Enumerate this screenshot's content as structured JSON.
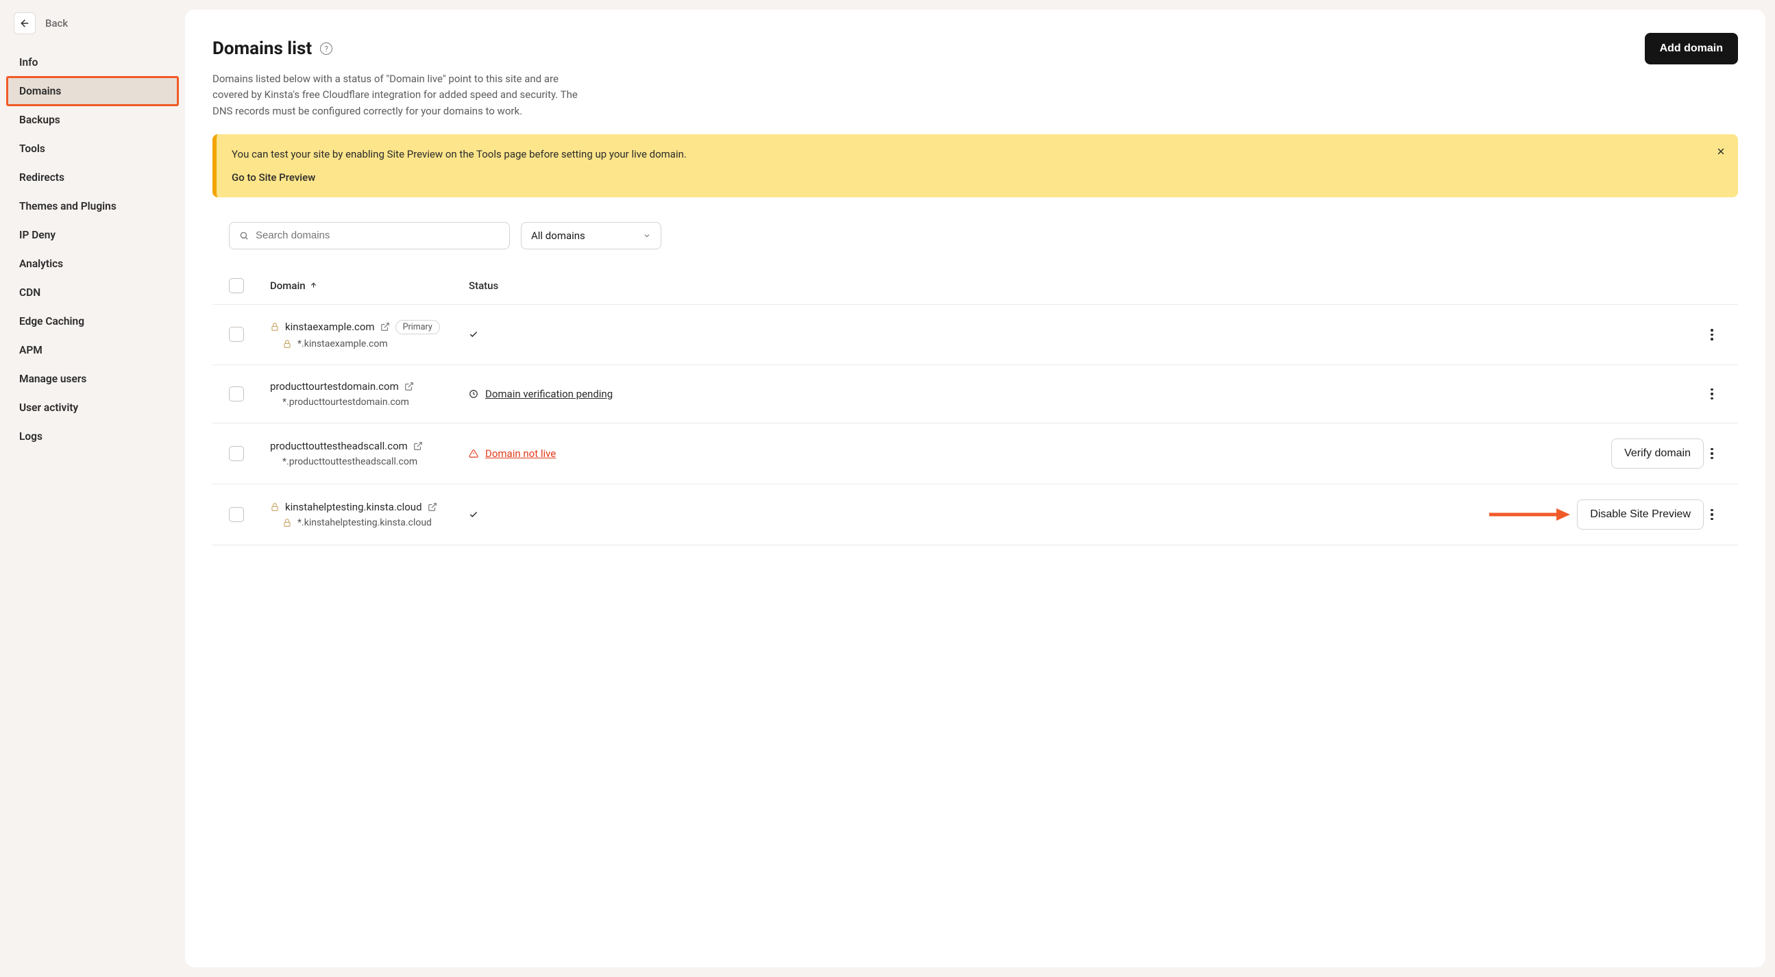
{
  "back_label": "Back",
  "sidebar": {
    "items": [
      {
        "label": "Info"
      },
      {
        "label": "Domains"
      },
      {
        "label": "Backups"
      },
      {
        "label": "Tools"
      },
      {
        "label": "Redirects"
      },
      {
        "label": "Themes and Plugins"
      },
      {
        "label": "IP Deny"
      },
      {
        "label": "Analytics"
      },
      {
        "label": "CDN"
      },
      {
        "label": "Edge Caching"
      },
      {
        "label": "APM"
      },
      {
        "label": "Manage users"
      },
      {
        "label": "User activity"
      },
      {
        "label": "Logs"
      }
    ],
    "active_index": 1
  },
  "header": {
    "title": "Domains list",
    "add_button": "Add domain"
  },
  "subtitle": "Domains listed below with a status of \"Domain live\" point to this site and are covered by Kinsta's free Cloudflare integration for added speed and security. The DNS records must be configured correctly for your domains to work.",
  "banner": {
    "text": "You can test your site by enabling Site Preview on the Tools page before setting up your live domain.",
    "link": "Go to Site Preview"
  },
  "controls": {
    "search_placeholder": "Search domains",
    "filter_selected": "All domains"
  },
  "table": {
    "columns": {
      "domain": "Domain",
      "status": "Status"
    },
    "rows": [
      {
        "domain": "kinstaexample.com",
        "wildcard": "*.kinstaexample.com",
        "has_lock": true,
        "has_external": true,
        "primary_label": "Primary",
        "status_type": "ok",
        "status_text": "",
        "action_button": ""
      },
      {
        "domain": "producttourtestdomain.com",
        "wildcard": "*.producttourtestdomain.com",
        "has_lock": false,
        "has_external": true,
        "status_type": "pending",
        "status_text": "Domain verification pending",
        "action_button": ""
      },
      {
        "domain": "producttouttestheadscall.com",
        "wildcard": "*.producttouttestheadscall.com",
        "has_lock": false,
        "has_external": true,
        "status_type": "error",
        "status_text": "Domain not live",
        "action_button": "Verify domain"
      },
      {
        "domain": "kinstahelptesting.kinsta.cloud",
        "wildcard": "*.kinstahelptesting.kinsta.cloud",
        "has_lock": true,
        "has_external": true,
        "status_type": "ok",
        "status_text": "",
        "action_button": "Disable Site Preview",
        "arrow_highlight": true
      }
    ]
  }
}
